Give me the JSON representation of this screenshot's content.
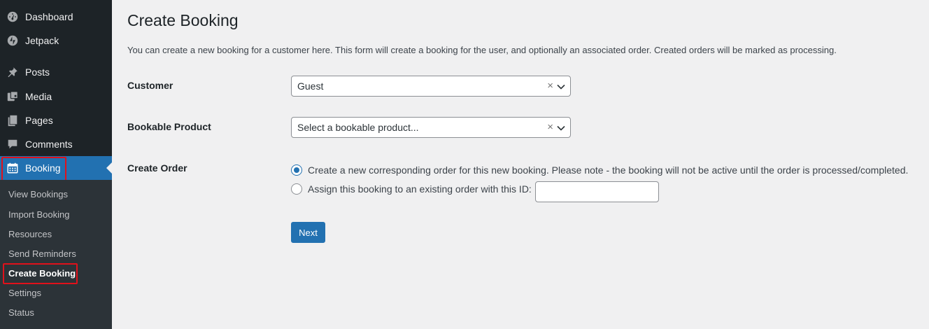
{
  "sidebar": {
    "items": [
      {
        "label": "Dashboard",
        "icon": "dashboard-icon"
      },
      {
        "label": "Jetpack",
        "icon": "jetpack-icon"
      },
      {
        "label": "Posts",
        "icon": "pin-icon"
      },
      {
        "label": "Media",
        "icon": "media-icon"
      },
      {
        "label": "Pages",
        "icon": "pages-icon"
      },
      {
        "label": "Comments",
        "icon": "comment-icon"
      },
      {
        "label": "Booking",
        "icon": "calendar-icon"
      }
    ],
    "submenu": [
      {
        "label": "View Bookings"
      },
      {
        "label": "Import Booking"
      },
      {
        "label": "Resources"
      },
      {
        "label": "Send Reminders"
      },
      {
        "label": "Create Booking"
      },
      {
        "label": "Settings"
      },
      {
        "label": "Status"
      }
    ],
    "colors": {
      "background": "#1d2327",
      "active": "#2271b1",
      "submenu_bg": "#2c3338",
      "highlight": "#e0111b"
    }
  },
  "main": {
    "title": "Create Booking",
    "intro": "You can create a new booking for a customer here. This form will create a booking for the user, and optionally an associated order. Created orders will be marked as processing.",
    "customer": {
      "label": "Customer",
      "value": "Guest"
    },
    "product": {
      "label": "Bookable Product",
      "placeholder": "Select a bookable product..."
    },
    "order": {
      "label": "Create Order",
      "option_new": "Create a new corresponding order for this new booking. Please note - the booking will not be active until the order is processed/completed.",
      "option_existing": "Assign this booking to an existing order with this ID:",
      "order_id_value": ""
    },
    "next_label": "Next"
  }
}
